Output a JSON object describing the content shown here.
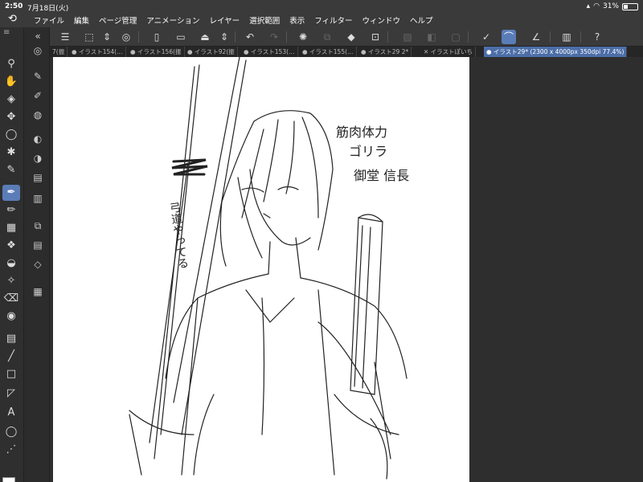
{
  "status": {
    "time": "2:50",
    "date": "7月18日(火)",
    "battery": "31%",
    "battery_level": 0.31
  },
  "app": {
    "logo_icon": "clip-studio-logo-icon"
  },
  "menu": [
    "ファイル",
    "編集",
    "ページ管理",
    "アニメーション",
    "レイヤー",
    "選択範囲",
    "表示",
    "フィルター",
    "ウィンドウ",
    "ヘルプ"
  ],
  "tabs": [
    {
      "label": "7(振",
      "active": false
    },
    {
      "label": "● イラスト154(…",
      "active": false
    },
    {
      "label": "● イラスト156(振",
      "active": false
    },
    {
      "label": "● イラスト92(振",
      "active": false
    },
    {
      "label": "● イラスト153(…",
      "active": false
    },
    {
      "label": "● イラスト155(…",
      "active": false
    },
    {
      "label": "● イラスト29 2*",
      "active": false
    },
    {
      "label": "✕ イラストぽいち",
      "active": false
    },
    {
      "label": "● イラスト29* (2300 x 4000px 350dpi 77.4%)",
      "active": true
    }
  ],
  "canvas_notes": {
    "note1": "筋肉体力",
    "note2": "ゴリラ",
    "note3": "御堂 信長",
    "note4": "弓道やってる"
  },
  "colors": {
    "accent": "#5a7db8",
    "main_color": "#ffffff",
    "sub_color": "#111111"
  }
}
